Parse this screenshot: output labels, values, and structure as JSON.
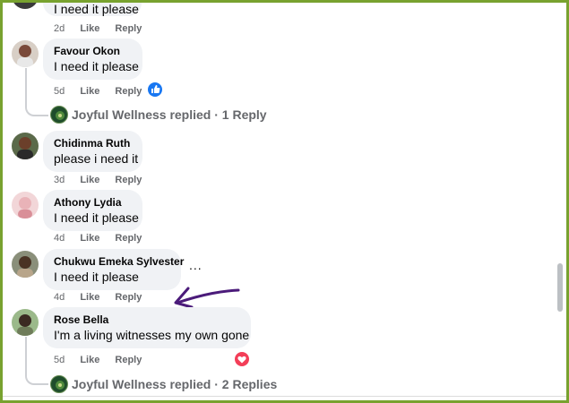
{
  "comments": [
    {
      "author": "",
      "text": "I need it please",
      "time": "2d",
      "like": "Like",
      "reply": "Reply"
    },
    {
      "author": "Favour Okon",
      "text": "I need it please",
      "time": "5d",
      "like": "Like",
      "reply": "Reply",
      "reaction": "like-reaction-icon"
    },
    {
      "author": "Chidinma Ruth",
      "text": "please i need it",
      "time": "3d",
      "like": "Like",
      "reply": "Reply"
    },
    {
      "author": "Athony Lydia",
      "text": "I need it please",
      "time": "4d",
      "like": "Like",
      "reply": "Reply"
    },
    {
      "author": "Chukwu Emeka Sylvester",
      "text": "I need it please",
      "time": "4d",
      "like": "Like",
      "reply": "Reply",
      "more": "..."
    },
    {
      "author": "Rose Bella",
      "text": "I'm a living witnesses my own gone",
      "time": "5d",
      "like": "Like",
      "reply": "Reply",
      "reaction": "love-reaction-icon"
    }
  ],
  "replies": [
    {
      "text": "Joyful Wellness replied · 1 Reply"
    },
    {
      "text": "Joyful Wellness replied · 2 Replies"
    }
  ],
  "colors": {
    "frame": "#78a22f",
    "bubble": "#f0f2f5",
    "secondary_text": "#65676b",
    "like_blue": "#1877f2",
    "love_red": "#f33e58",
    "arrow": "#4b1b7a"
  }
}
